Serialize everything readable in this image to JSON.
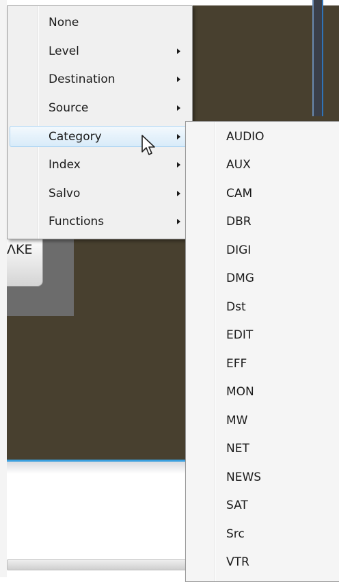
{
  "background": {
    "panel_color": "#48402f",
    "take_button_label": "ɅKE"
  },
  "context_menu": {
    "items": [
      {
        "label": "None",
        "has_submenu": false
      },
      {
        "label": "Level",
        "has_submenu": true
      },
      {
        "label": "Destination",
        "has_submenu": true
      },
      {
        "label": "Source",
        "has_submenu": true
      },
      {
        "label": "Category",
        "has_submenu": true,
        "highlighted": true
      },
      {
        "label": "Index",
        "has_submenu": true
      },
      {
        "label": "Salvo",
        "has_submenu": true
      },
      {
        "label": "Functions",
        "has_submenu": true
      }
    ]
  },
  "category_submenu": {
    "items": [
      "AUDIO",
      "AUX",
      "CAM",
      "DBR",
      "DIGI",
      "DMG",
      "Dst",
      "EDIT",
      "EFF",
      "MON",
      "MW",
      "NET",
      "NEWS",
      "SAT",
      "Src",
      "VTR"
    ]
  },
  "colors": {
    "highlight_border": "#a8d2f2",
    "accent_blue": "#3aa0e0"
  },
  "cursor": {
    "icon": "arrow-pointer-icon"
  }
}
